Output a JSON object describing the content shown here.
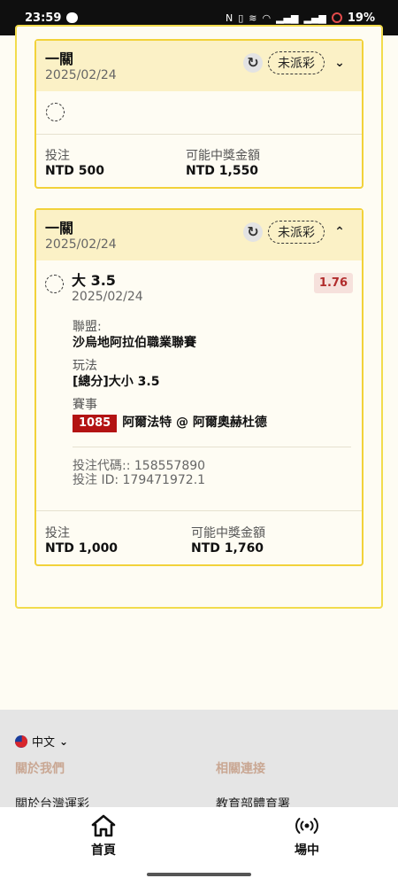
{
  "status_bar": {
    "time": "23:59",
    "icons": [
      "chat-icon",
      "nfc-icon",
      "vibrate-icon",
      "volte-icon",
      "wifi-icon",
      "signal-icon",
      "signal-icon",
      "battery-icon"
    ],
    "battery": "19%"
  },
  "bets": [
    {
      "title": "一關",
      "date": "2025/02/24",
      "status": "未派彩",
      "expanded": false,
      "stake_label": "投注",
      "stake": "NTD 500",
      "payout_label": "可能中獎金額",
      "payout": "NTD 1,550"
    },
    {
      "title": "一關",
      "date": "2025/02/24",
      "status": "未派彩",
      "expanded": true,
      "selection": {
        "name": "大 3.5",
        "date": "2025/02/24",
        "odds": "1.76",
        "league_label": "聯盟:",
        "league": "沙烏地阿拉伯職業聯賽",
        "market_label": "玩法",
        "market": "[總分]大小 3.5",
        "event_label": "賽事",
        "event_id": "1085",
        "event_name": "阿爾法特 @ 阿爾奧赫杜德",
        "bet_code": "投注代碼:: 158557890",
        "bet_id": "投注 ID: 179471972.1"
      },
      "stake_label": "投注",
      "stake": "NTD 1,000",
      "payout_label": "可能中獎金額",
      "payout": "NTD 1,760"
    }
  ],
  "footer": {
    "language": "中文",
    "about_heading": "關於我們",
    "links_heading": "相關連接",
    "about_link": "關於台灣運彩",
    "related_link": "教育部體育署"
  },
  "bottom_nav": [
    {
      "label": "首頁",
      "icon": "home-icon"
    },
    {
      "label": "場中",
      "icon": "live-broadcast-icon"
    }
  ]
}
